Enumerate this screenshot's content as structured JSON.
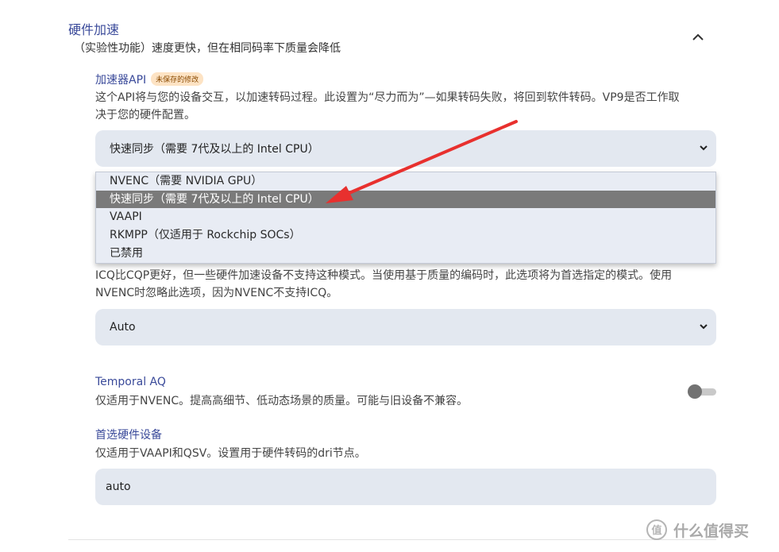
{
  "section": {
    "title": "硬件加速",
    "description": "（实验性功能）速度更快，但在相同码率下质量会降低"
  },
  "accelerator": {
    "label": "加速器API",
    "badge": "未保存的修改",
    "description_line1": "这个API将与您的设备交互，以加速转码过程。此设置为“尽力而为”—如果转码失败，将回到软件转码。VP9是否工作取",
    "description_line2": "决于您的硬件配置。",
    "selected": "快速同步（需要 7代及以上的 Intel CPU）",
    "options": [
      "NVENC（需要 NVIDIA GPU）",
      "快速同步（需要 7代及以上的 Intel CPU）",
      "VAAPI",
      "RKMPP（仅适用于 Rockchip SOCs）",
      "已禁用"
    ]
  },
  "rate_mode": {
    "description_line1": "ICQ比CQP更好，但一些硬件加速设备不支持这种模式。当使用基于质量的编码时，此选项将为首选指定的模式。使用",
    "description_line2": "NVENC时忽略此选项，因为NVENC不支持ICQ。",
    "selected": "Auto"
  },
  "temporal_aq": {
    "label": "Temporal AQ",
    "description": "仅适用于NVENC。提高高细节、低动态场景的质量。可能与旧设备不兼容。",
    "enabled": false
  },
  "preferred_device": {
    "label": "首选硬件设备",
    "description": "仅适用于VAAPI和QSV。设置用于硬件转码的dri节点。",
    "value": "auto"
  },
  "watermark": {
    "text": "什么值得买",
    "logo": "值"
  },
  "colors": {
    "label": "#3a4a9a",
    "select_bg": "#e3e8f0",
    "selected_option": "#7a7a7a",
    "arrow": "#e8302e"
  },
  "icons": [
    "chevron-up-icon",
    "chevron-down-icon",
    "annotation-arrow-icon",
    "watermark-logo-icon"
  ]
}
